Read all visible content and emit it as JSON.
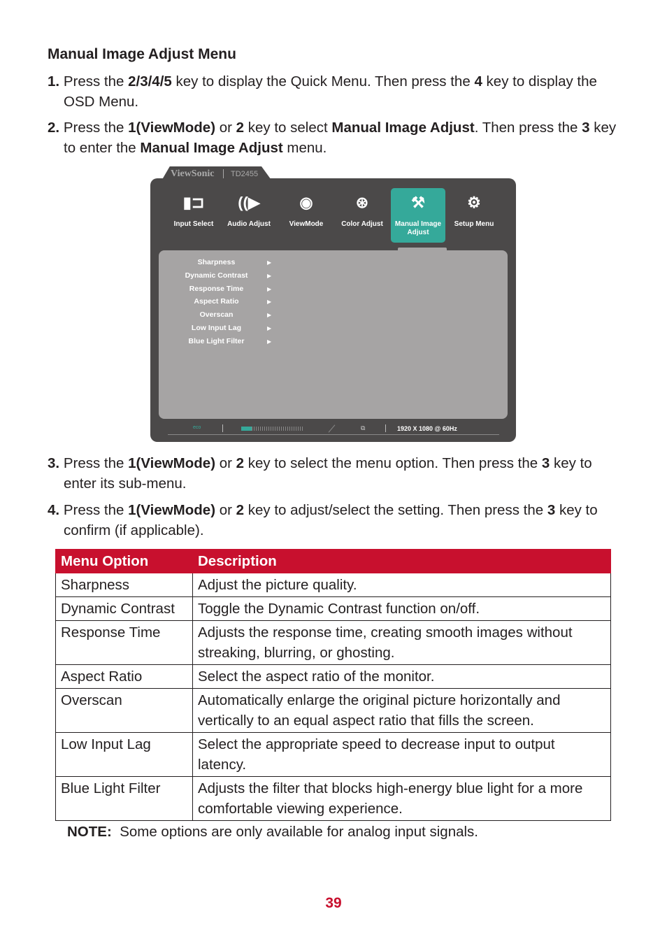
{
  "heading": "Manual Image Adjust Menu",
  "steps": [
    {
      "num": "1.",
      "html": "Press the <b>2/3/4/5</b> key to display the Quick Menu. Then press the <b>4</b> key to display the OSD Menu."
    },
    {
      "num": "2.",
      "html": "Press the <b>1(ViewMode)</b> or <b>2</b> key to select <b>Manual Image Adjust</b>. Then press the <b>3</b> key to enter the <b>Manual Image Adjust</b> menu."
    },
    {
      "num": "3.",
      "html": "Press the <b>1(ViewMode)</b> or <b>2</b> key to select the menu option. Then press the <b>3</b> key to enter its sub-menu."
    },
    {
      "num": "4.",
      "html": "Press the <b>1(ViewMode)</b> or <b>2</b> key to adjust/select the setting. Then press the <b>3</b> key to confirm (if applicable)."
    }
  ],
  "osd": {
    "brand": "ViewSonic",
    "model": "TD2455",
    "menu": [
      {
        "label": "Input Select",
        "icon": "input-icon"
      },
      {
        "label": "Audio Adjust",
        "icon": "speaker-icon"
      },
      {
        "label": "ViewMode",
        "icon": "eye-icon"
      },
      {
        "label": "Color Adjust",
        "icon": "color-circles-icon"
      },
      {
        "label": "Manual Image Adjust",
        "icon": "manual-image-icon",
        "selected": true
      },
      {
        "label": "Setup Menu",
        "icon": "gear-icon"
      }
    ],
    "options": [
      "Sharpness",
      "Dynamic Contrast",
      "Response Time",
      "Aspect Ratio",
      "Overscan",
      "Low Input Lag",
      "Blue Light Filter"
    ],
    "eco_label": "eco",
    "eco_level": 0.17,
    "resolution": "1920 X 1080 @ 60Hz",
    "accent": "#35a99a"
  },
  "table": {
    "headers": [
      "Menu Option",
      "Description"
    ],
    "rows": [
      [
        "Sharpness",
        "Adjust the picture quality."
      ],
      [
        "Dynamic Contrast",
        "Toggle the Dynamic Contrast function on/off."
      ],
      [
        "Response Time",
        "Adjusts the response time, creating smooth images without streaking, blurring, or ghosting."
      ],
      [
        "Aspect Ratio",
        "Select the aspect ratio of the monitor."
      ],
      [
        "Overscan",
        "Automatically enlarge the original picture horizontally and vertically to an equal aspect ratio that fills the screen."
      ],
      [
        "Low Input Lag",
        "Select the appropriate speed to decrease input to output latency."
      ],
      [
        "Blue Light Filter",
        "Adjusts the filter that blocks high-energy blue light for a more comfortable viewing experience."
      ]
    ],
    "header_color": "#c8102e"
  },
  "note": {
    "label": "NOTE:",
    "text": "Some options are only available for analog input signals."
  },
  "page_number": "39"
}
